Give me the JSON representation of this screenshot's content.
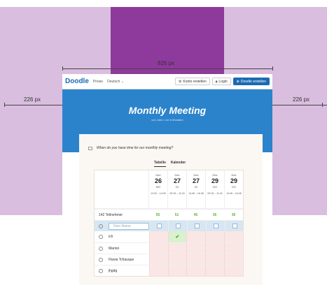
{
  "annotations": {
    "total_width": "826 px",
    "left_margin": "226 px",
    "right_margin": "226 px"
  },
  "header": {
    "logo": "Doodle",
    "nav_prices": "Preise",
    "nav_language": "Deutsch",
    "btn_account": "Konto erstellen",
    "btn_login": "Login",
    "btn_create": "Doodle erstellen"
  },
  "hero": {
    "title": "Monthly Meeting",
    "subtitle": "von John • vor 6 Monaten"
  },
  "poll": {
    "question": "When do you have time for our monthly meeting?",
    "tabs": [
      "Tabelle",
      "Kalender"
    ],
    "dates": [
      {
        "month": "Dez",
        "day": "26",
        "weekday": "MO",
        "time": "12:00 – 14:00"
      },
      {
        "month": "Dez",
        "day": "27",
        "weekday": "DI",
        "time": "09:15 – 11:15"
      },
      {
        "month": "Dez",
        "day": "27",
        "weekday": "DI",
        "time": "14:45 – 16:45"
      },
      {
        "month": "Dez",
        "day": "29",
        "weekday": "DO",
        "time": "09:15 – 11:15"
      },
      {
        "month": "Dez",
        "day": "29",
        "weekday": "DO",
        "time": "14:45 – 16:45"
      }
    ],
    "participants_label": "142 Teilnehmer",
    "counts": [
      "55",
      "51",
      "45",
      "36",
      "36"
    ],
    "name_placeholder": "Dein Name",
    "people": [
      {
        "name": "ich",
        "yes": [
          false,
          true,
          false,
          false,
          false
        ]
      },
      {
        "name": "Marion",
        "yes": [
          false,
          false,
          false,
          false,
          false
        ]
      },
      {
        "name": "Flavia Tchauque",
        "yes": [
          false,
          false,
          false,
          false,
          false
        ]
      },
      {
        "name": "jhgdg",
        "yes": [
          false,
          false,
          false,
          false,
          false
        ]
      }
    ]
  },
  "colors": {
    "accent": "#1a6ab3",
    "hero": "#2b83cc",
    "yes": "#49a82e",
    "no_bg": "#fbe6e6"
  }
}
